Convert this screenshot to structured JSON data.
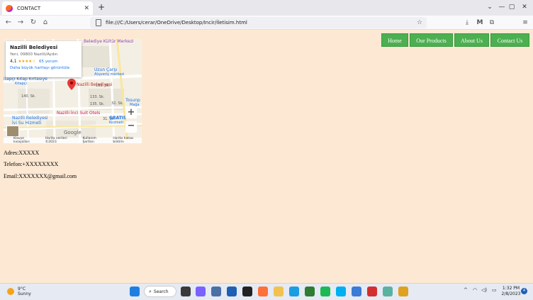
{
  "browser": {
    "tab_title": "CONTACT",
    "tab_close": "✕",
    "new_tab": "+",
    "url": "file:///C:/Users/cerar/OneDrive/Desktop/Incir/İletisim.html",
    "window_controls": {
      "list": "⌄",
      "minimize": "—",
      "maximize": "▢",
      "close": "✕"
    },
    "nav": {
      "back": "←",
      "forward": "→",
      "reload": "↻",
      "home": "⌂"
    },
    "tools": {
      "bookmark": "☆",
      "downloads": "⤓",
      "account": "M",
      "extensions": "⧉",
      "menu": "≡"
    }
  },
  "nav_menu": {
    "home": "Home",
    "products": "Our Products",
    "about": "About Us",
    "contact": "Contact Us"
  },
  "map": {
    "place_name": "Nazilli Belediyesi",
    "address": "Yeni, 09800 Nazilli/Aydın",
    "rating": "4,1",
    "stars": "★★★★☆",
    "reviews": "65 yorum",
    "larger_map": "Daha büyük haritayı görüntüle",
    "labels": {
      "culture_center": "Belediye Kültür Merkezi",
      "bazaar": "Uzun Çarşı",
      "bazaar_sub": "Alışveriş merkezi",
      "bookstore": "itapçı Kitap Kırtasiye",
      "bookstore_sub": "Kitapçı",
      "pin": "Nazilli Belediyesi",
      "street1": "133. Sk.",
      "street2": "135. Sk.",
      "street3": "140. Sk.",
      "street4": "133. Sk.",
      "street5": "31. Sk.",
      "street6": "32. Sk.",
      "tosun": "Tosunp",
      "tosun_sub": "Mağa",
      "hotel": "Nazilli İnci Suit Otels",
      "water": "Nazilli Belediyesi",
      "water_sub": "İvi Su Hizmeti",
      "gratis": "GRATIS",
      "gratis_sub": "Kozmeti",
      "google": "Google"
    },
    "zoom_in": "+",
    "zoom_out": "−",
    "attribution": {
      "shortcuts": "Klavye kısayolları",
      "data": "Harita verileri ©2023",
      "terms": "Kullanım Şartları",
      "report": "Harita hatası bildirin"
    }
  },
  "contact": {
    "address": "Adres:XXXXX",
    "phone": "Telefon:+XXXXXXXX",
    "email": "Email:XXXXXXX@gmail.com"
  },
  "taskbar": {
    "temperature": "9°C",
    "condition": "Sunny",
    "search": "Search",
    "time": "1:32 PM",
    "date": "2/8/2023",
    "notif": "4"
  },
  "colors": {
    "page_bg": "#fde9d3",
    "button_green": "#4caf50",
    "map_pin": "#e53935",
    "link_blue": "#1a73e8"
  }
}
